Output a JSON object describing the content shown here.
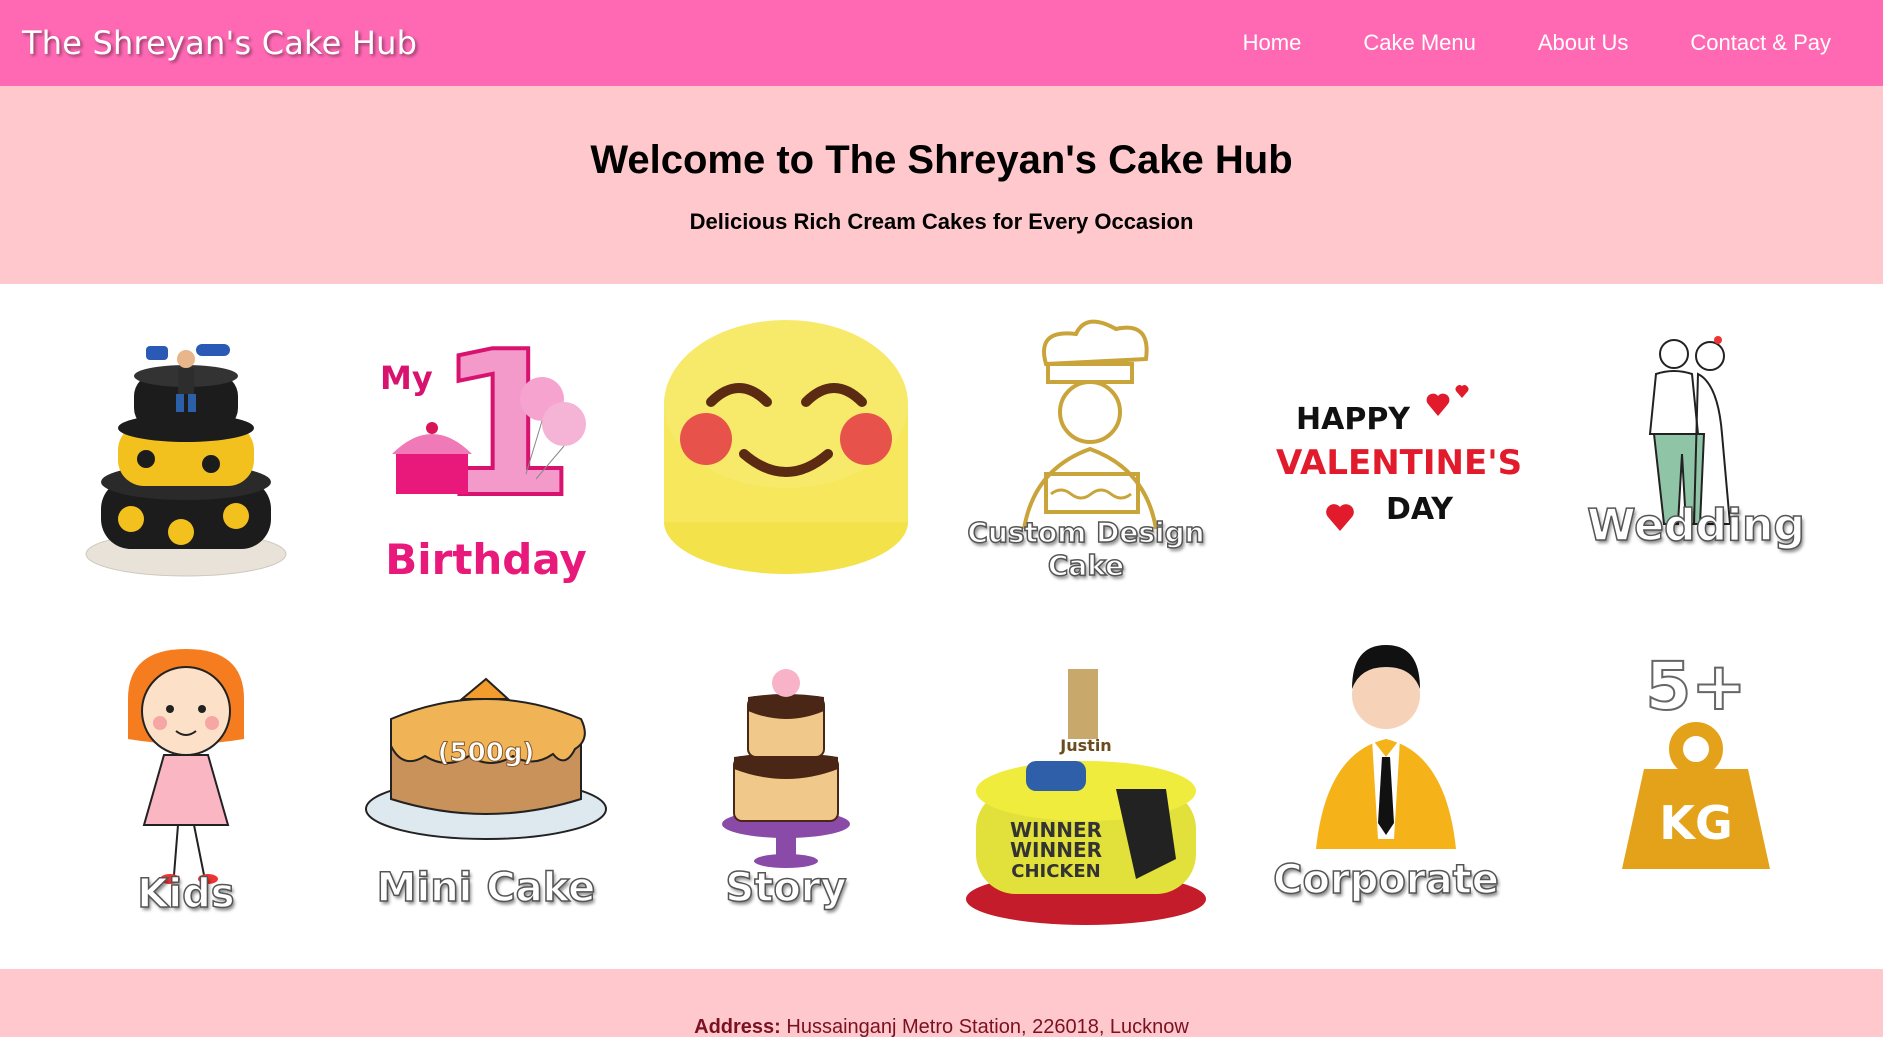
{
  "brand": "The Shreyan's Cake Hub",
  "nav": {
    "home": "Home",
    "menu": "Cake Menu",
    "about": "About Us",
    "contact": "Contact & Pay"
  },
  "hero": {
    "title": "Welcome to The Shreyan's Cake Hub",
    "subtitle": "Delicious Rich Cream Cakes for Every Occasion"
  },
  "tiles": {
    "birthday": {
      "line1": "My",
      "number": "1",
      "line2": "Birthday"
    },
    "custom": {
      "label": "Custom Design Cake"
    },
    "valentine": {
      "line1": "HAPPY",
      "line2": "VALENTINE'S",
      "line3": "DAY"
    },
    "wedding": {
      "label": "Wedding"
    },
    "kids": {
      "label": "Kids"
    },
    "mini": {
      "label": "Mini Cake",
      "badge": "(500g)"
    },
    "story": {
      "label": "Story"
    },
    "pubg": {
      "topper": "Justin",
      "text1": "WINNER",
      "text2": "WINNER",
      "text3": "CHICKEN"
    },
    "corporate": {
      "label": "Corporate"
    },
    "weight": {
      "top": "5+",
      "unit": "KG"
    }
  },
  "footer": {
    "address_label": "Address:",
    "address_value": "Hussainganj Metro Station, 226018, Lucknow"
  },
  "colors": {
    "nav_bg": "#ff69b4",
    "hero_bg": "#ffc8cc",
    "address_text": "#7a1020"
  }
}
